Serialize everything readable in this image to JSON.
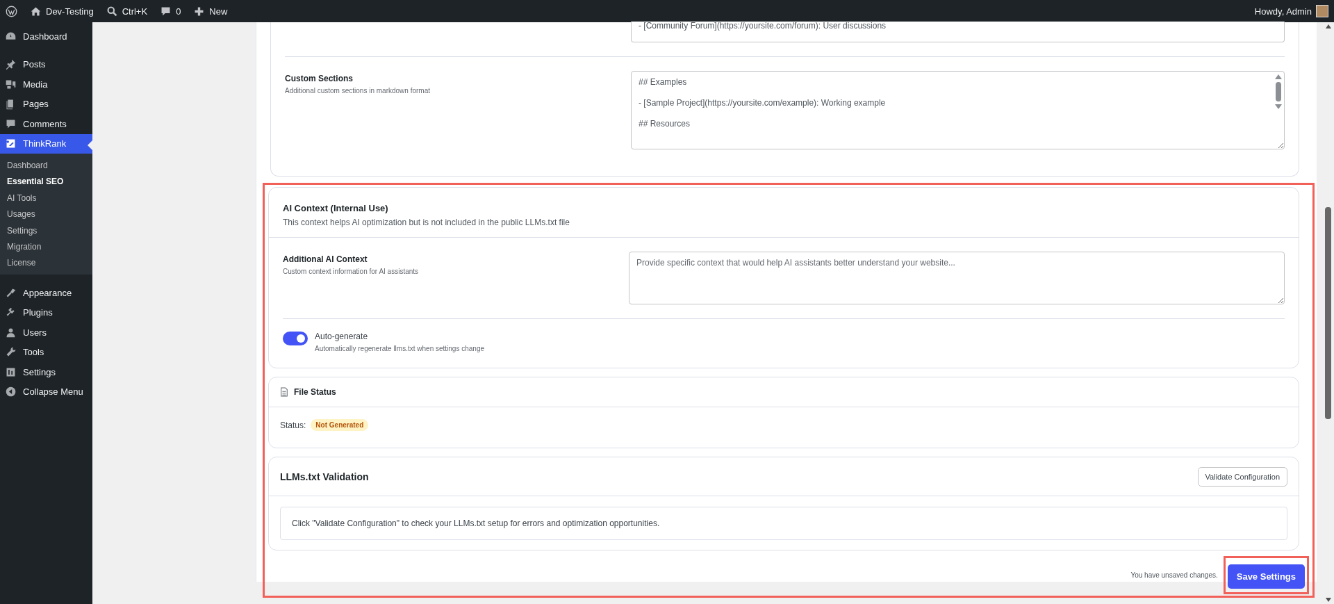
{
  "admin_bar": {
    "site": "Dev-Testing",
    "search": "Ctrl+K",
    "comments": "0",
    "new": "New",
    "greeting": "Howdy, Admin"
  },
  "sidebar": {
    "groups": [
      {
        "items": [
          {
            "label": "Dashboard",
            "selected": false
          }
        ]
      },
      {
        "items": [
          {
            "label": "Posts",
            "selected": false
          },
          {
            "label": "Media",
            "selected": false
          },
          {
            "label": "Pages",
            "selected": false
          },
          {
            "label": "Comments",
            "selected": false
          },
          {
            "label": "ThinkRank",
            "selected": true,
            "children": [
              {
                "label": "Dashboard",
                "selected": false
              },
              {
                "label": "Essential SEO",
                "selected": true
              },
              {
                "label": "AI Tools",
                "selected": false
              },
              {
                "label": "Usages",
                "selected": false
              },
              {
                "label": "Settings",
                "selected": false
              },
              {
                "label": "Migration",
                "selected": false
              },
              {
                "label": "License",
                "selected": false
              }
            ]
          }
        ]
      },
      {
        "items": [
          {
            "label": "Appearance",
            "selected": false
          },
          {
            "label": "Plugins",
            "selected": false
          },
          {
            "label": "Users",
            "selected": false
          },
          {
            "label": "Tools",
            "selected": false
          },
          {
            "label": "Settings",
            "selected": false
          },
          {
            "label": "Collapse Menu",
            "selected": false
          }
        ]
      }
    ]
  },
  "links_card": {
    "top_field_value": "- [Community Forum](https://yoursite.com/forum): User discussions",
    "custom_sections": {
      "label": "Custom Sections",
      "description": "Additional custom sections in markdown format",
      "value": "## Examples\n\n- [Sample Project](https://yoursite.com/example): Working example\n\n## Resources"
    }
  },
  "ai_context": {
    "title": "AI Context (Internal Use)",
    "description": "This context helps AI optimization but is not included in the public LLMs.txt file",
    "additional": {
      "label": "Additional AI Context",
      "description": "Custom context information for AI assistants",
      "placeholder": "Provide specific context that would help AI assistants better understand your website..."
    },
    "auto_generate": {
      "label": "Auto-generate",
      "description": "Automatically regenerate llms.txt when settings change",
      "on": true
    }
  },
  "file_status": {
    "title": "File Status",
    "status_label": "Status:",
    "status": "Not Generated"
  },
  "validation": {
    "title": "LLMs.txt Validation",
    "button": "Validate Configuration",
    "message": "Click \"Validate Configuration\" to check your LLMs.txt setup for errors and optimization opportunities."
  },
  "footer": {
    "note": "You have unsaved changes.",
    "save_button": "Save Settings"
  }
}
